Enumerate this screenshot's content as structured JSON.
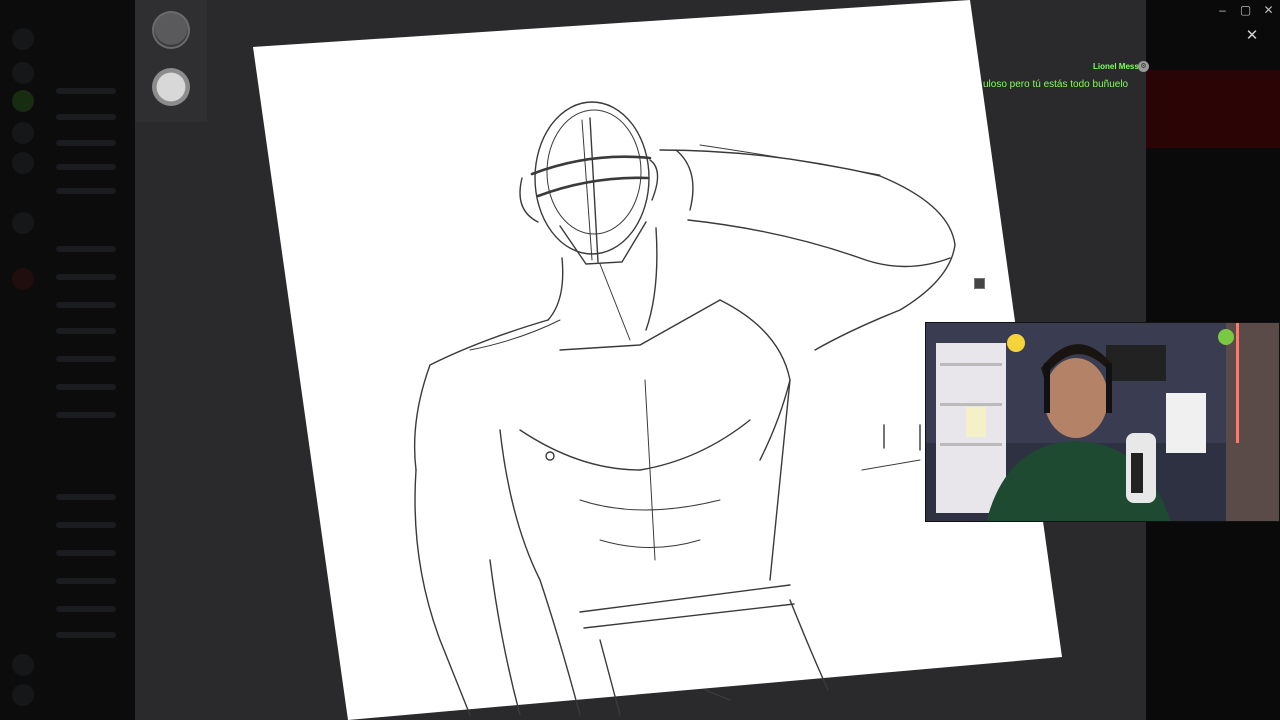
{
  "window": {
    "controls": {
      "minimize": "–",
      "maximize": "▢",
      "close": "✕"
    }
  },
  "overlay": {
    "close_label": "✕"
  },
  "tools": [
    {
      "name": "dark-brush",
      "color": "#4a4a4c"
    },
    {
      "name": "light-brush",
      "color": "#cfcfcf"
    }
  ],
  "chat": {
    "username": "Lionel Messi",
    "username_color": "#7fff5a",
    "message": "uloso pero tú estás todo buñuelo",
    "badge_icon": "gear-icon"
  },
  "colors": {
    "stage_bg": "#2a2a2c",
    "paper": "#ffffff",
    "sketch_stroke": "#3a3a3a",
    "chat_text": "#7fff5a"
  }
}
